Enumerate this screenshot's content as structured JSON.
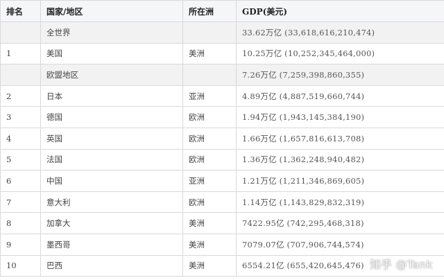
{
  "table": {
    "headers": [
      "排名",
      "国家/地区",
      "所在洲",
      "GDP(美元)"
    ],
    "rows": [
      {
        "rank": "",
        "country": "全世界",
        "continent": "",
        "gdp": "33.62万亿 (33,618,616,210,474)",
        "aggregate": true
      },
      {
        "rank": "1",
        "country": "美国",
        "continent": "美洲",
        "gdp": "10.25万亿 (10,252,345,464,000)",
        "aggregate": false
      },
      {
        "rank": "",
        "country": "欧盟地区",
        "continent": "",
        "gdp": "7.26万亿 (7,259,398,860,355)",
        "aggregate": true
      },
      {
        "rank": "2",
        "country": "日本",
        "continent": "亚洲",
        "gdp": "4.89万亿 (4,887,519,660,744)",
        "aggregate": false
      },
      {
        "rank": "3",
        "country": "德国",
        "continent": "欧洲",
        "gdp": "1.94万亿 (1,943,145,384,190)",
        "aggregate": false
      },
      {
        "rank": "4",
        "country": "英国",
        "continent": "欧洲",
        "gdp": "1.66万亿 (1,657,816,613,708)",
        "aggregate": false
      },
      {
        "rank": "5",
        "country": "法国",
        "continent": "欧洲",
        "gdp": "1.36万亿 (1,362,248,940,482)",
        "aggregate": false
      },
      {
        "rank": "6",
        "country": "中国",
        "continent": "亚洲",
        "gdp": "1.21万亿 (1,211,346,869,605)",
        "aggregate": false
      },
      {
        "rank": "7",
        "country": "意大利",
        "continent": "欧洲",
        "gdp": "1.14万亿 (1,143,829,832,319)",
        "aggregate": false
      },
      {
        "rank": "8",
        "country": "加拿大",
        "continent": "美洲",
        "gdp": "7422.95亿 (742,295,468,318)",
        "aggregate": false
      },
      {
        "rank": "9",
        "country": "墨西哥",
        "continent": "美洲",
        "gdp": "7079.07亿 (707,906,744,574)",
        "aggregate": false
      },
      {
        "rank": "10",
        "country": "巴西",
        "continent": "美洲",
        "gdp": "6554.21亿 (655,420,645,476)",
        "aggregate": false
      }
    ]
  },
  "watermark": "知乎 @Tank",
  "colors": {
    "header_bg": "#f5f6f8",
    "aggregate_row_bg": "#f2f2f2",
    "border": "#d9d9d9"
  }
}
